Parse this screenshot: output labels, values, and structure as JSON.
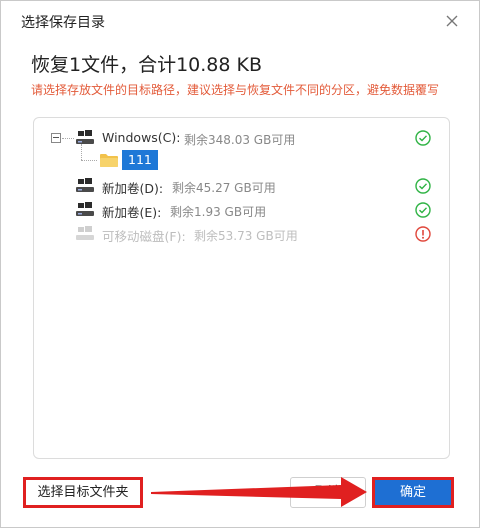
{
  "dialog": {
    "title": "选择保存目录",
    "headline": "恢复1文件，合计10.88 KB",
    "hint": "请选择存放文件的目标路径，建议选择与恢复文件不同的分区，避免数据覆写"
  },
  "tree": {
    "drives": [
      {
        "name": "Windows(C):",
        "free": "剩余348.03 GB可用",
        "status": "ok"
      },
      {
        "name": "新加卷(D):",
        "free": "剩余45.27 GB可用",
        "status": "ok"
      },
      {
        "name": "新加卷(E):",
        "free": "剩余1.93 GB可用",
        "status": "ok"
      },
      {
        "name": "可移动磁盘(F):",
        "free": "剩余53.73 GB可用",
        "status": "error"
      }
    ],
    "folder": {
      "name": "111"
    }
  },
  "footer": {
    "select_folder_label": "选择目标文件夹",
    "cancel_label": "取消",
    "ok_label": "确定"
  },
  "colors": {
    "accent": "#1e6fd3",
    "ok": "#2fb344",
    "error": "#e0463a",
    "highlight": "#e02020",
    "hint": "#e35b3a"
  },
  "icons": {
    "close": "close-icon",
    "drive": "windows-drive-icon",
    "folder": "folder-icon",
    "ok": "check-circle-icon",
    "error": "info-error-icon"
  }
}
